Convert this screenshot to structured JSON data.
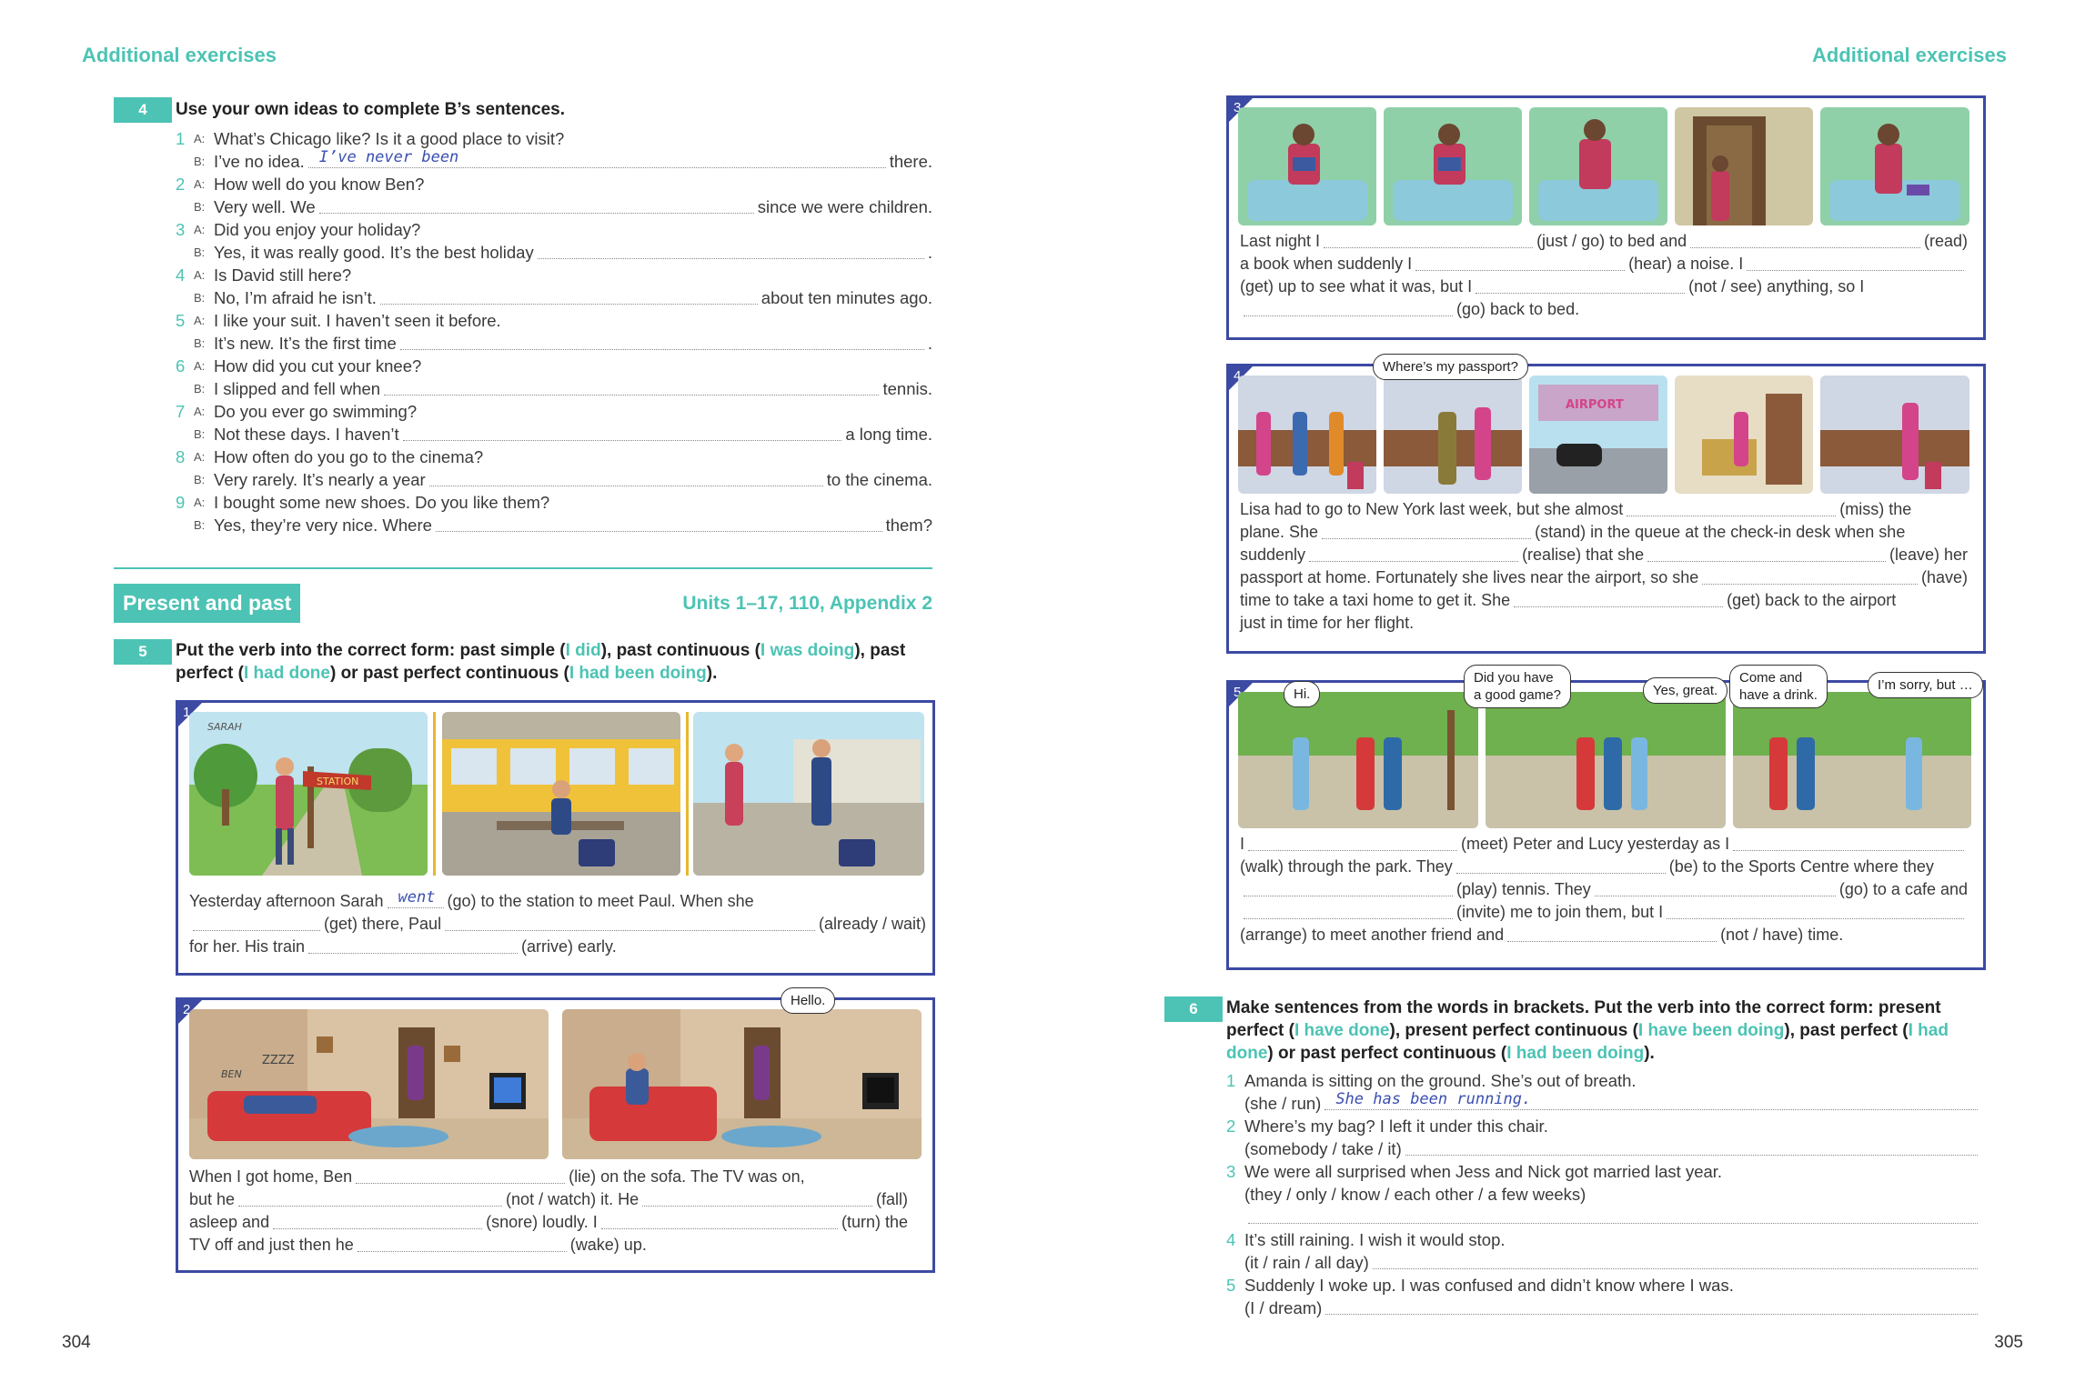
{
  "left_page": {
    "header": "Additional exercises",
    "page_number": "304",
    "ex4": {
      "num": "4",
      "instruction": "Use your own ideas to complete B’s sentences.",
      "items": [
        {
          "n": "1",
          "a": "What’s Chicago like?  Is it a good place to visit?",
          "b_pre": "I’ve no idea.",
          "b_post": "there.",
          "answer": "I’ve never been"
        },
        {
          "n": "2",
          "a": "How well do you know Ben?",
          "b_pre": "Very well.  We",
          "b_post": "since we were children."
        },
        {
          "n": "3",
          "a": "Did you enjoy your holiday?",
          "b_pre": "Yes, it was really good.  It’s the best holiday",
          "b_post": "."
        },
        {
          "n": "4",
          "a": "Is David still here?",
          "b_pre": "No, I’m afraid he isn’t.",
          "b_post": "about ten minutes ago."
        },
        {
          "n": "5",
          "a": "I like your suit.  I haven’t seen it before.",
          "b_pre": "It’s new.  It’s the first time",
          "b_post": "."
        },
        {
          "n": "6",
          "a": "How did you cut your knee?",
          "b_pre": "I slipped and fell when",
          "b_post": "tennis."
        },
        {
          "n": "7",
          "a": "Do you ever go swimming?",
          "b_pre": "Not these days.  I haven’t",
          "b_post": "a long time."
        },
        {
          "n": "8",
          "a": "How often do you go to the cinema?",
          "b_pre": "Very rarely.  It’s nearly a year",
          "b_post": "to the cinema."
        },
        {
          "n": "9",
          "a": "I bought some new shoes.  Do you like them?",
          "b_pre": "Yes, they’re very nice.  Where",
          "b_post": "them?"
        }
      ],
      "a_label": "A:",
      "b_label": "B:"
    },
    "section": {
      "title": "Present and past",
      "units": "Units 1–17, 110, Appendix 2"
    },
    "ex5": {
      "num": "5",
      "instr_parts": [
        "Put the verb into the correct form: past simple (",
        "I did",
        "), past continuous (",
        "I was doing",
        "), past",
        "perfect (",
        "I had done",
        ") or past perfect continuous (",
        "I had been doing",
        ")."
      ],
      "panel1": {
        "num": "1",
        "name_label": "SARAH",
        "sign_label": "STATION",
        "lines": [
          [
            "Yesterday afternoon Sarah",
            "went",
            "(go) to the station to meet Paul.  When she"
          ],
          [
            "",
            "(get) there, Paul",
            "(already / wait)"
          ],
          [
            "for her.  His train",
            "(arrive) early."
          ]
        ]
      },
      "panel2": {
        "num": "2",
        "bubble": "Hello.",
        "name_label": "BEN",
        "zzz": "ZZZZ",
        "lines": [
          [
            "When I got home, Ben",
            "(lie) on the sofa.  The TV was on,"
          ],
          [
            "but he",
            "(not / watch) it.  He",
            "(fall)"
          ],
          [
            "asleep and",
            "(snore) loudly.  I",
            "(turn) the"
          ],
          [
            "TV off and just then he",
            "(wake) up."
          ]
        ]
      }
    }
  },
  "right_page": {
    "header": "Additional exercises",
    "page_number": "305",
    "panel3": {
      "num": "3",
      "lines": [
        [
          "Last night I",
          "(just / go) to bed and",
          "(read)"
        ],
        [
          "a book when suddenly I",
          "(hear) a noise.  I"
        ],
        [
          "(get) up to see what it was, but I",
          "(not / see) anything, so I"
        ],
        [
          "(go) back to bed."
        ]
      ]
    },
    "panel4": {
      "num": "4",
      "bubble": "Where’s my passport?",
      "sign": "AIRPORT",
      "lines": [
        [
          "Lisa had to go to New York last week, but she almost",
          "(miss) the"
        ],
        [
          "plane.  She",
          "(stand) in the queue at the check-in desk when she"
        ],
        [
          "suddenly",
          "(realise) that she",
          "(leave) her"
        ],
        [
          "passport at home.  Fortunately she lives near the airport, so she",
          "(have)"
        ],
        [
          "time to take a taxi home to get it.  She",
          "(get) back to the airport"
        ],
        [
          "just in time for her flight."
        ]
      ]
    },
    "panel5": {
      "num": "5",
      "bubbles": [
        "Hi.",
        "Did you have",
        "a good game?",
        "Yes, great.",
        "Come and",
        "have a drink.",
        "I’m sorry, but …"
      ],
      "lines": [
        [
          "I",
          "(meet) Peter and Lucy yesterday as I"
        ],
        [
          "(walk) through the park.  They",
          "(be) to the Sports Centre where they"
        ],
        [
          "(play) tennis.  They",
          "(go) to a cafe and"
        ],
        [
          "(invite) me to join them, but I"
        ],
        [
          "(arrange) to meet another friend and",
          "(not / have) time."
        ]
      ]
    },
    "ex6": {
      "num": "6",
      "instr_parts": [
        "Make sentences from the words in brackets.  Put the verb into the correct form: present",
        "perfect (",
        "I have done",
        "), present perfect continuous (",
        "I have been doing",
        "), past perfect (",
        "I had",
        "done",
        ") or past perfect continuous (",
        "I had been doing",
        ")."
      ],
      "items": [
        {
          "n": "1",
          "q": "Amanda is sitting on the ground.  She’s out of breath.",
          "cue": "(she / run)",
          "answer": "She has been running."
        },
        {
          "n": "2",
          "q": "Where’s my bag?  I left it under this chair.",
          "cue": "(somebody / take / it)"
        },
        {
          "n": "3",
          "q": "We were all surprised when Jess and Nick got married last year.",
          "cue": "(they / only / know / each other / a few weeks)"
        },
        {
          "n": "4",
          "q": "It’s still raining.  I wish it would stop.",
          "cue": "(it / rain / all day)"
        },
        {
          "n": "5",
          "q": "Suddenly I woke up.  I was confused and didn’t know where I was.",
          "cue": "(I / dream)"
        }
      ]
    }
  }
}
